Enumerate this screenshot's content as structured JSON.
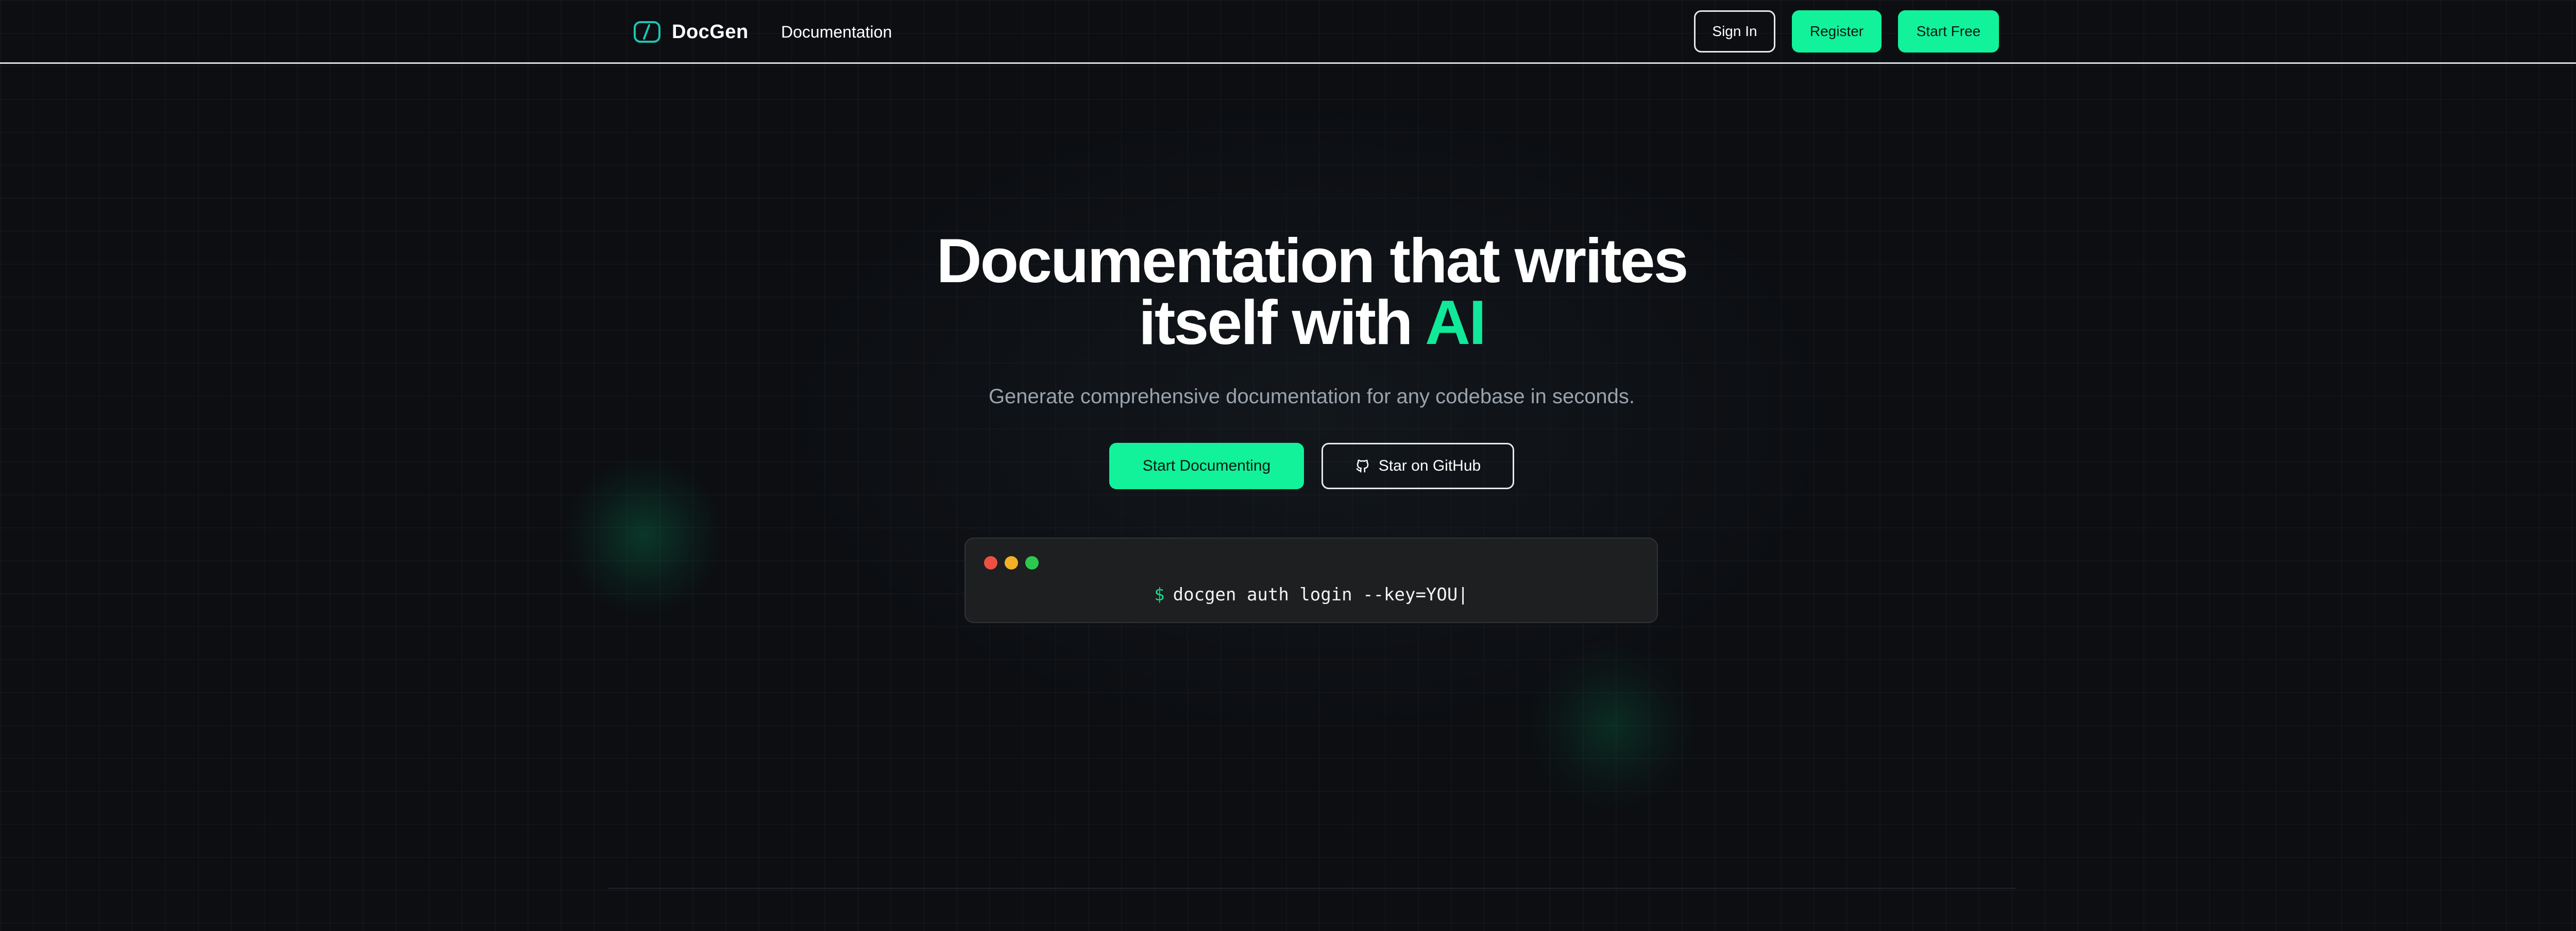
{
  "header": {
    "brand_name": "DocGen",
    "brand_icon": "code-brackets-icon",
    "nav": {
      "documentation_label": "Documentation"
    },
    "actions": {
      "sign_in_label": "Sign In",
      "register_label": "Register",
      "start_free_label": "Start Free"
    }
  },
  "hero": {
    "title_line1": "Documentation that writes",
    "title_line2_prefix": "itself with",
    "title_accent": "AI",
    "subtitle": "Generate comprehensive documentation for any codebase in seconds.",
    "cta_primary_label": "Start Documenting",
    "cta_secondary_label": "Star on GitHub",
    "cta_secondary_icon": "github-icon"
  },
  "terminal": {
    "prompt": "$",
    "command": "docgen auth login --key=YOU|",
    "window_dots": [
      "red",
      "yellow",
      "green"
    ]
  },
  "colors": {
    "background": "#0c0e12",
    "accent": "#11f29a",
    "accent_text": "#12e89a",
    "subtitle": "#9aa3ad",
    "terminal_bg": "#1e1f21",
    "dot_red": "#ee4f45",
    "dot_yellow": "#f2b125",
    "dot_green": "#2cc94e"
  }
}
